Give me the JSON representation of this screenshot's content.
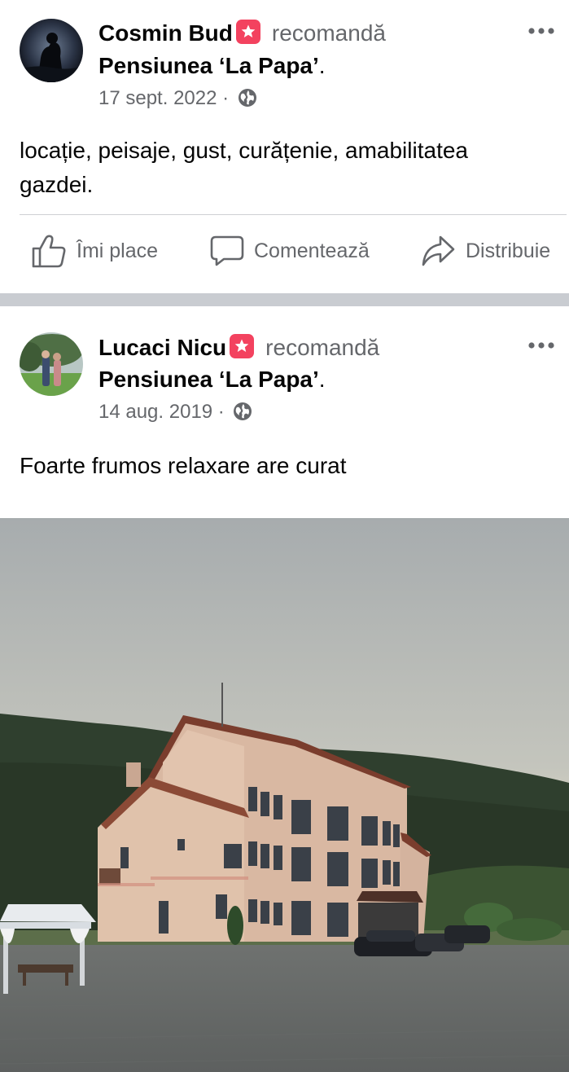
{
  "posts": [
    {
      "author": "Cosmin Bud",
      "verb": "recomandă",
      "page": "Pensiunea ‘La Papa’",
      "period": ".",
      "date": "17 sept. 2022",
      "separator": " · ",
      "text": "locație, peisaje, gust, curățenie, amabilitatea gazdei.",
      "actions": {
        "like": "Îmi place",
        "comment": "Comentează",
        "share": "Distribuie"
      }
    },
    {
      "author": "Lucaci Nicu",
      "verb": "recomandă",
      "page": "Pensiunea ‘La Papa’",
      "period": ".",
      "date": "14 aug. 2019",
      "separator": " · ",
      "text": "Foarte frumos relaxare are curat"
    }
  ],
  "icons": {
    "badge": "recommendation-star-icon",
    "audience": "globe-icon",
    "menu": "more-options-icon",
    "like": "thumbs-up-icon",
    "comment": "comment-bubble-icon",
    "share": "share-arrow-icon"
  },
  "colors": {
    "secondary_text": "#65676b",
    "badge": "#f3425f",
    "separator": "#c9ccd1"
  }
}
